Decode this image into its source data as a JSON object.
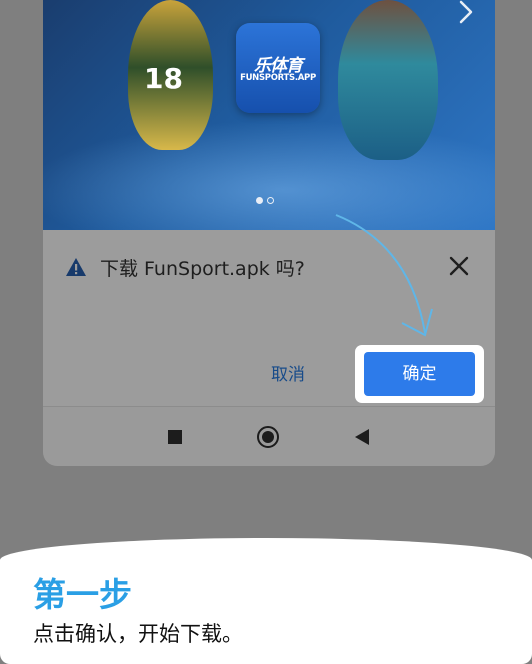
{
  "banner": {
    "logo_cn": "乐体育",
    "logo_en": "FUNSPORTS.APP",
    "jersey_number": "18",
    "carousel_dots": 2,
    "active_dot": 0
  },
  "dialog": {
    "message": "下载 FunSport.apk 吗?",
    "cancel_label": "取消",
    "confirm_label": "确定"
  },
  "caption": {
    "title": "第一步",
    "description": "点击确认，开始下载。"
  },
  "colors": {
    "accent": "#2d7bea",
    "title_blue": "#2a9fe5",
    "arrow": "#5fb6e8"
  }
}
